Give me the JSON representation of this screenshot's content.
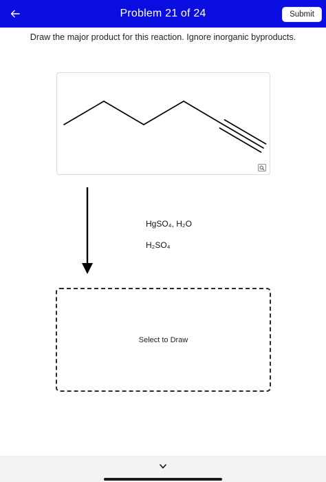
{
  "header": {
    "back_icon": "arrow-left-icon",
    "title": "Problem 21 of 24",
    "submit_label": "Submit",
    "background_color": "#0a0de0"
  },
  "question": {
    "instruction": "Draw the major product for this reaction. Ignore inorganic byproducts."
  },
  "starting_material": {
    "structure": "hex-1-yne skeletal structure",
    "zoom_icon": "magnifier-icon"
  },
  "reaction": {
    "arrow_icon": "arrow-down-icon",
    "reagents": [
      "HgSO₄, H₂O",
      "H₂SO₄"
    ]
  },
  "answer_area": {
    "label": "Select to Draw"
  },
  "footer": {
    "chevron_icon": "chevron-down-icon"
  }
}
